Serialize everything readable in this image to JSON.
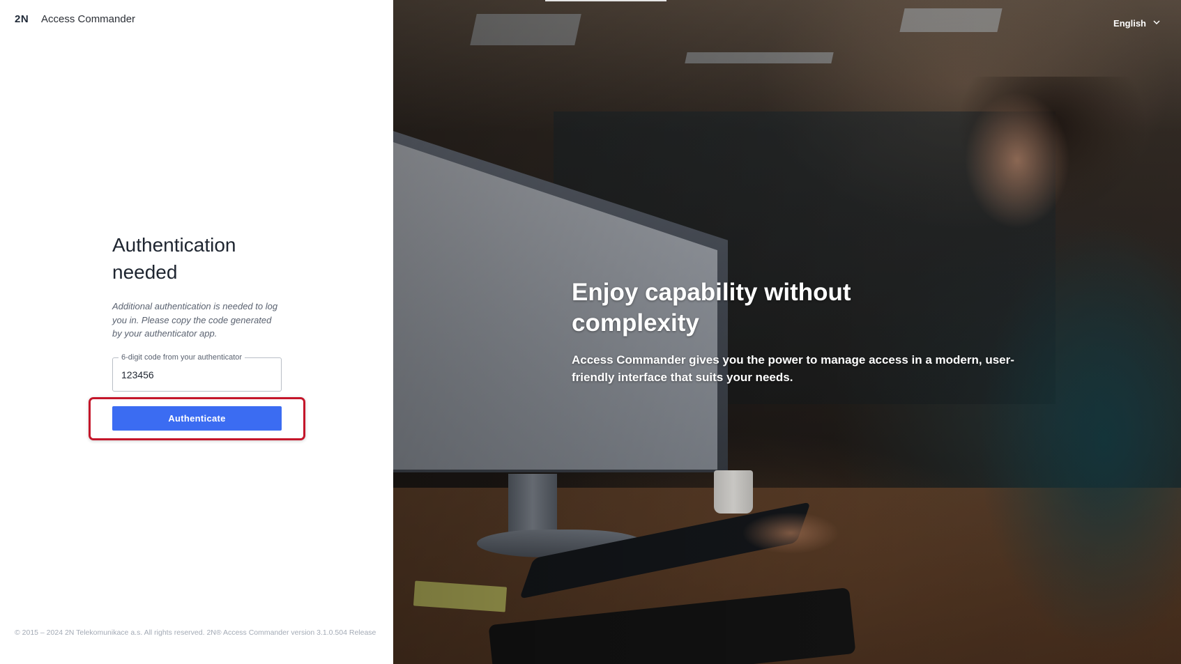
{
  "header": {
    "logo_text": "2N",
    "app_name": "Access Commander"
  },
  "auth": {
    "title": "Authentication needed",
    "description": "Additional authentication is needed to log you in. Please copy the code generated by your authenticator app.",
    "code_field": {
      "label": "6-digit code from your authenticator",
      "value": "123456"
    },
    "button_label": "Authenticate",
    "highlight_color": "#c4162a",
    "button_color": "#3b6cf2"
  },
  "footer": {
    "text": "© 2015 – 2024 2N Telekomunikace a.s. All rights reserved. 2N® Access Commander version 3.1.0.504 Release"
  },
  "language": {
    "selected": "English",
    "icon": "chevron-down-icon"
  },
  "hero": {
    "title": "Enjoy capability without complexity",
    "subtitle": "Access Commander gives you the power to manage access in a modern, user-friendly interface that suits your needs."
  }
}
